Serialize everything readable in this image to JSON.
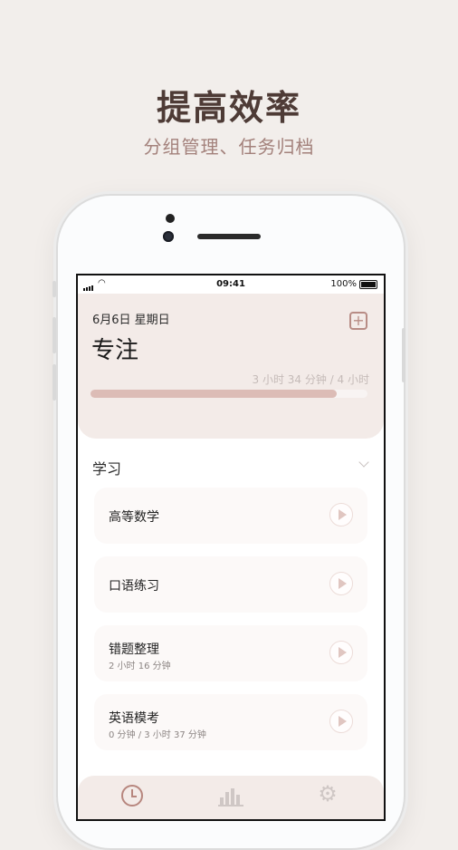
{
  "promo": {
    "headline": "提高效率",
    "subheadline": "分组管理、任务归档"
  },
  "status_bar": {
    "time": "09:41",
    "battery_percent": "100%"
  },
  "header": {
    "date": "6月6日 星期日",
    "title": "专注",
    "progress_text": "3 小时 34 分钟 / 4 小时",
    "progress_fraction": 0.89
  },
  "group": {
    "title": "学习",
    "tasks": [
      {
        "name": "高等数学",
        "sub": ""
      },
      {
        "name": "口语练习",
        "sub": ""
      },
      {
        "name": "错题整理",
        "sub": "2 小时 16 分钟"
      },
      {
        "name": "英语模考",
        "sub": "0 分钟 / 3 小时 37 分钟"
      }
    ]
  },
  "next_group_peek": "",
  "icons": {
    "add": "plus-square-icon",
    "collapse": "chevron-down-icon",
    "play": "play-icon",
    "tab_timer": "alarm-clock-icon",
    "tab_stats": "bar-chart-icon",
    "tab_settings": "gear-icon"
  },
  "colors": {
    "accent": "#b7867e",
    "progress_fill": "#dcbcb6",
    "card_bg": "#f3ebe8",
    "page_bg": "#f2eeeb"
  }
}
